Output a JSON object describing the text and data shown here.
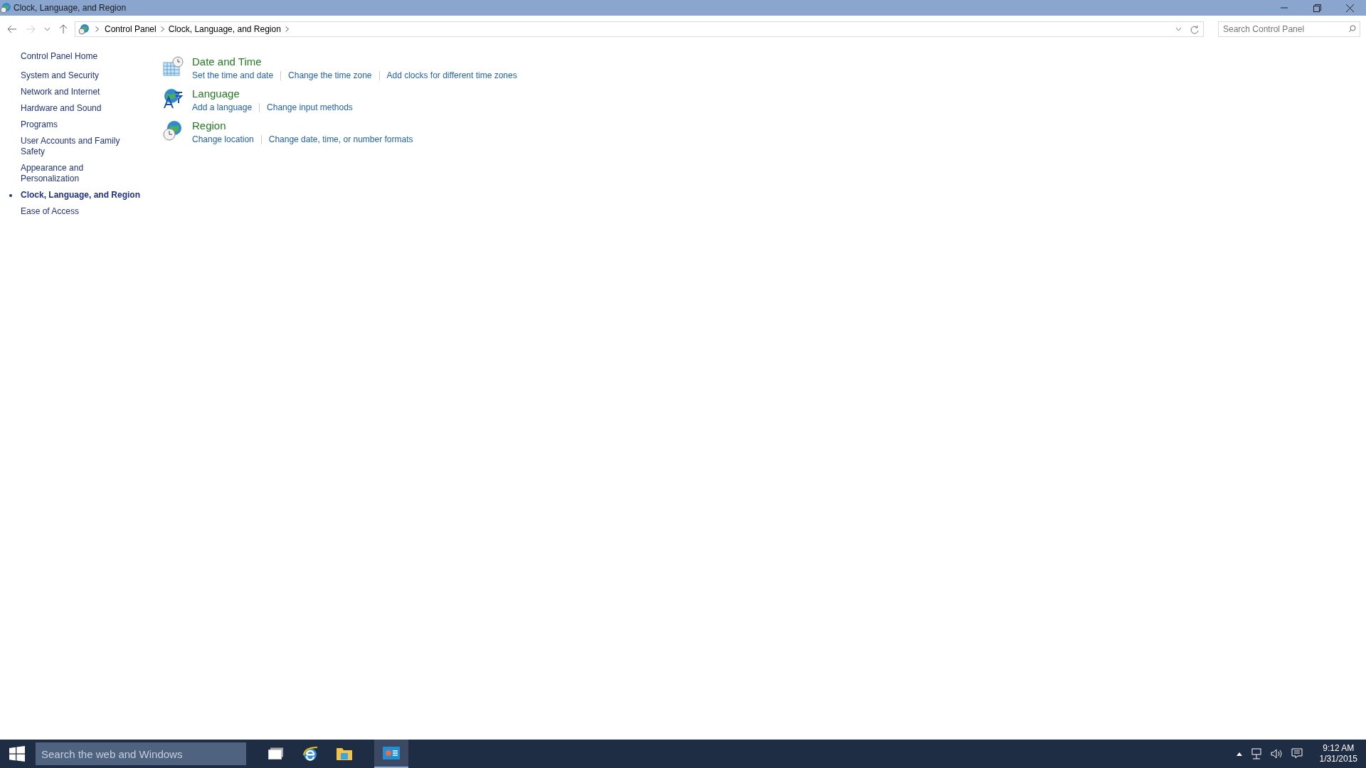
{
  "window": {
    "title": "Clock, Language, and Region"
  },
  "address_bar": {
    "crumbs": [
      "Control Panel",
      "Clock, Language, and Region"
    ]
  },
  "search": {
    "placeholder": "Search Control Panel"
  },
  "sidebar": {
    "home": "Control Panel Home",
    "items": [
      {
        "label": "System and Security",
        "selected": false
      },
      {
        "label": "Network and Internet",
        "selected": false
      },
      {
        "label": "Hardware and Sound",
        "selected": false
      },
      {
        "label": "Programs",
        "selected": false
      },
      {
        "label": "User Accounts and Family Safety",
        "selected": false
      },
      {
        "label": "Appearance and Personalization",
        "selected": false
      },
      {
        "label": "Clock, Language, and Region",
        "selected": true
      },
      {
        "label": "Ease of Access",
        "selected": false
      }
    ]
  },
  "categories": [
    {
      "kind": "clock",
      "title": "Date and Time",
      "links": [
        "Set the time and date",
        "Change the time zone",
        "Add clocks for different time zones"
      ]
    },
    {
      "kind": "language",
      "title": "Language",
      "links": [
        "Add a language",
        "Change input methods"
      ]
    },
    {
      "kind": "region",
      "title": "Region",
      "links": [
        "Change location",
        "Change date, time, or number formats"
      ]
    }
  ],
  "taskbar": {
    "search_placeholder": "Search the web and Windows",
    "time": "9:12 AM",
    "date": "1/31/2015"
  }
}
